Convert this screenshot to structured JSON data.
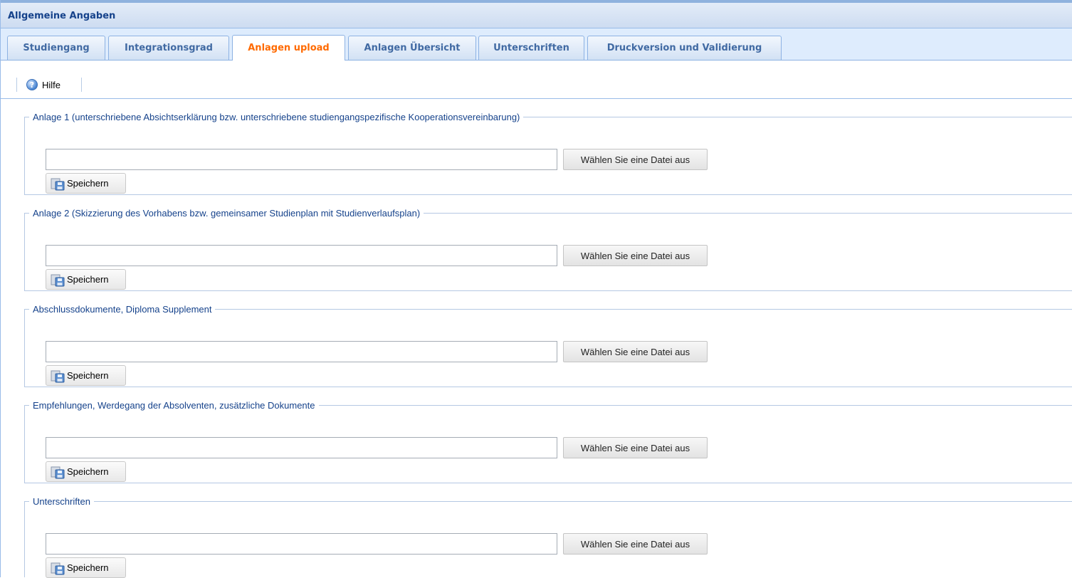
{
  "panel": {
    "title": "Allgemeine Angaben"
  },
  "tabs": [
    {
      "label": "Studiengang",
      "active": false
    },
    {
      "label": "Integrationsgrad",
      "active": false
    },
    {
      "label": "Anlagen upload",
      "active": true
    },
    {
      "label": "Anlagen Übersicht",
      "active": false
    },
    {
      "label": "Unterschriften",
      "active": false
    },
    {
      "label": "Druckversion und Validierung",
      "active": false
    }
  ],
  "toolbar": {
    "help_label": "Hilfe",
    "help_icon": "help-icon"
  },
  "colors": {
    "accent": "#15428b",
    "active_tab": "#ff6a00",
    "tab_text": "#416aa3"
  },
  "upload_groups": [
    {
      "legend": "Anlage 1 (unterschriebene Absichtserklärung bzw. unterschriebene studiengangspezifische Kooperationsvereinbarung)",
      "file_value": "",
      "browse_label": "Wählen Sie eine Datei aus",
      "save_label": "Speichern"
    },
    {
      "legend": "Anlage 2 (Skizzierung des Vorhabens bzw. gemeinsamer Studienplan mit Studienverlaufsplan)",
      "file_value": "",
      "browse_label": "Wählen Sie eine Datei aus",
      "save_label": "Speichern"
    },
    {
      "legend": "Abschlussdokumente, Diploma Supplement",
      "file_value": "",
      "browse_label": "Wählen Sie eine Datei aus",
      "save_label": "Speichern"
    },
    {
      "legend": "Empfehlungen, Werdegang der Absolventen, zusätzliche Dokumente",
      "file_value": "",
      "browse_label": "Wählen Sie eine Datei aus",
      "save_label": "Speichern"
    },
    {
      "legend": "Unterschriften",
      "file_value": "",
      "browse_label": "Wählen Sie eine Datei aus",
      "save_label": "Speichern"
    }
  ]
}
